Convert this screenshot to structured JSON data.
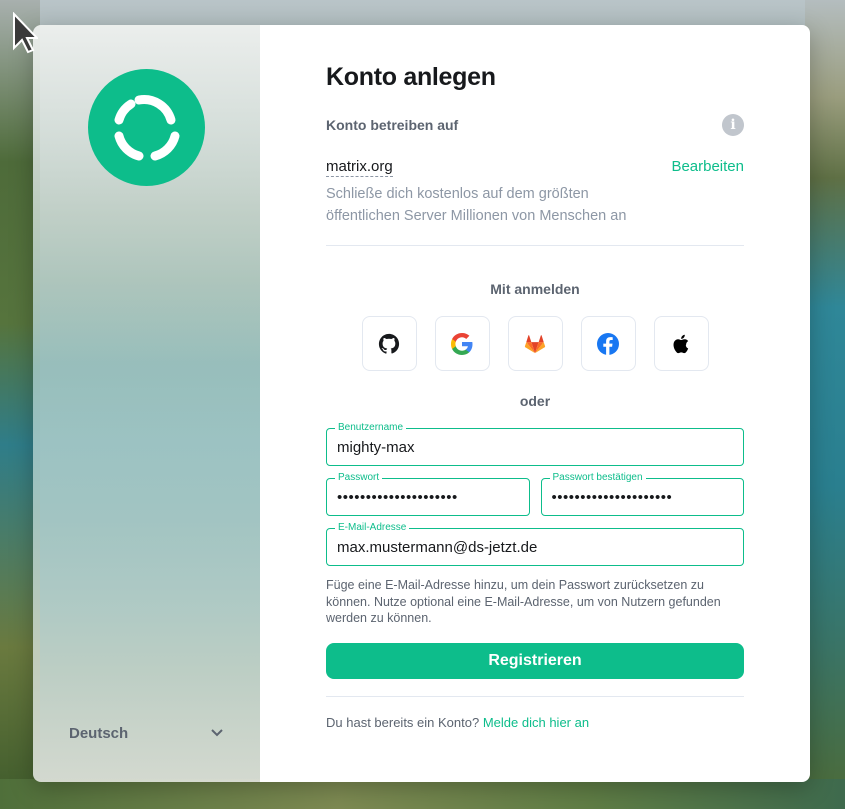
{
  "page": {
    "title": "Konto anlegen"
  },
  "server": {
    "label": "Konto betreiben auf",
    "name": "matrix.org",
    "edit_label": "Bearbeiten",
    "description": "Schließe dich kostenlos auf dem größten öffentlichen Server Millionen von Menschen an"
  },
  "sso": {
    "label": "Mit anmelden",
    "providers": [
      "github-icon",
      "google-icon",
      "gitlab-icon",
      "facebook-icon",
      "apple-icon"
    ]
  },
  "or_label": "oder",
  "form": {
    "username": {
      "label": "Benutzername",
      "value": "mighty-max"
    },
    "password": {
      "label": "Passwort",
      "value": "•••••••••••••••••••••"
    },
    "password_confirm": {
      "label": "Passwort bestätigen",
      "value": "•••••••••••••••••••••"
    },
    "email": {
      "label": "E-Mail-Adresse",
      "value": "max.mustermann@ds-jetzt.de"
    },
    "email_help": "Füge eine E-Mail-Adresse hinzu, um dein Passwort zurücksetzen zu können. Nutze optional eine E-Mail-Adresse, um von Nutzern gefunden werden zu können.",
    "submit_label": "Registrieren"
  },
  "footer": {
    "prompt": "Du hast bereits ein Konto?",
    "login_link": "Melde dich hier an"
  },
  "sidebar": {
    "language": "Deutsch"
  },
  "colors": {
    "accent": "#0dbd8b",
    "text": "#17191c",
    "muted": "#5c6470"
  }
}
